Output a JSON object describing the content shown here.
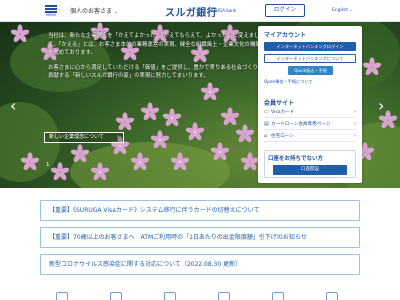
{
  "header": {
    "menu_label": "MENU",
    "nav_personal": "個人のお客さま",
    "logo": "スルガ銀行",
    "logo_en": "SURUGA bank",
    "login": "ログイン",
    "lang": "English"
  },
  "hero": {
    "paragraph1": "当社は、新たな企業理念を「かえてよかった」「かえてもらえて、よかった」に変えまして。「かえる」とは、お客さま本位の業務運営の実現、健全な組織風土・企業文化の構築を進めております。",
    "paragraph2": "お客さまに心から満足していただける「価値」をご提供し、豊かで実りある社会づくりに貢献する「新しいスルガ銀行の姿」の実現に努力してまいります。",
    "more_button": "新しい企業理念について",
    "pager": "1",
    "colors": {
      "flower": "#d9a4d0",
      "flower_center": "#f3e7f2",
      "foliage": "#3f6b2a"
    }
  },
  "panel": {
    "my_account": {
      "heading": "マイアカウント",
      "btn_login": "インターネットバンキングログイン",
      "btn_internet": "インターネットバンキングについて",
      "btn_quick": "Quick振込・手続",
      "link_open": "Open預金・手続について"
    },
    "member_site": {
      "heading": "会員サイト",
      "links": [
        {
          "icon": "card-icon",
          "label": "Visaカード"
        },
        {
          "icon": "loan-icon",
          "label": "カードローン会員専用ページ"
        },
        {
          "icon": "house-icon",
          "label": "住宅ローン"
        }
      ]
    },
    "account_open": {
      "heading": "口座をお持ちでない方",
      "button": "口座開設"
    }
  },
  "notices": [
    "【重要】《SURUGA Visaカード》システム移行に伴うカードの切替えについて",
    "【重要】70歳以上のお客さまへ　ATMご利用時の「1日あたりの出金限度額」引下げのお知らせ",
    "新型コロナウイルス感染症に関する対応について（2022.08.30 更新）"
  ],
  "colors": {
    "brand": "#1e4f9c",
    "button": "#1f5ea8",
    "notice_border": "#9cc2e6"
  }
}
